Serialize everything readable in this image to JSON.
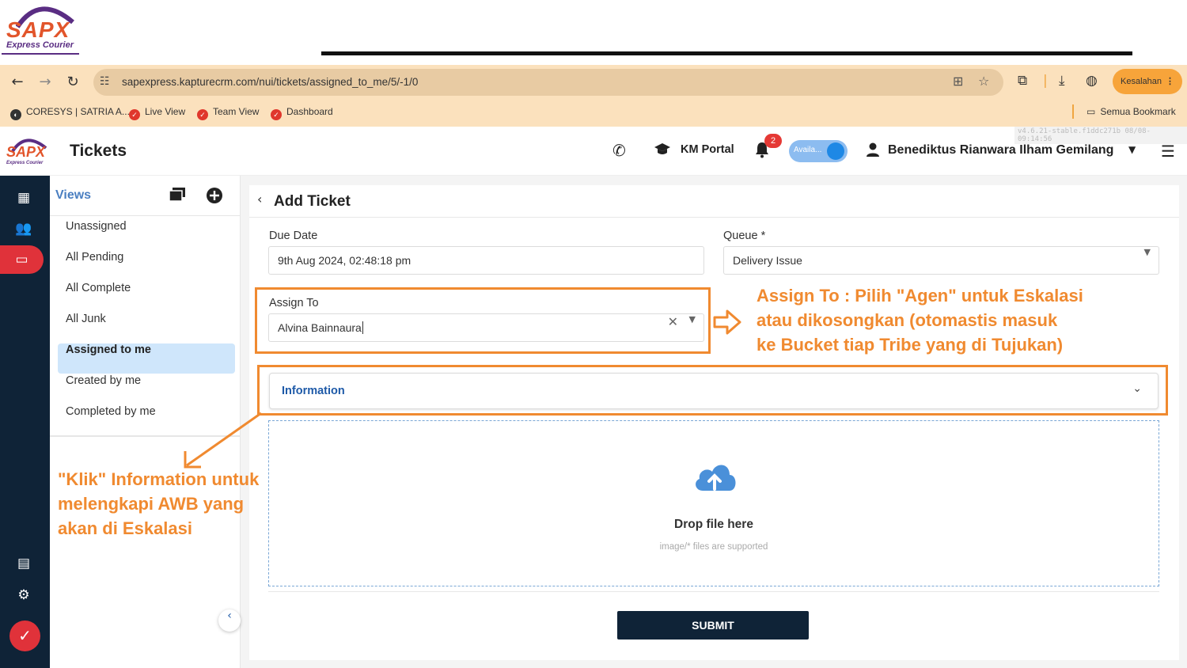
{
  "slide": {
    "logo_word": "SAPX",
    "logo_sub": "Express Courier"
  },
  "browser": {
    "url": "sapexpress.kapturecrm.com/nui/tickets/assigned_to_me/5/-1/0",
    "error_button": "Kesalahan",
    "bookmarks": [
      {
        "label": "CORESYS | SATRIA A..."
      },
      {
        "label": "Live View"
      },
      {
        "label": "Team View"
      },
      {
        "label": "Dashboard"
      }
    ],
    "all_bookmarks": "Semua Bookmark"
  },
  "header": {
    "logo_word": "SAPX",
    "logo_sub": "Express Courier",
    "title": "Tickets",
    "version": "v4.6.21-stable.f1ddc271b 08/08-09:14:56",
    "km_portal": "KM Portal",
    "notification_count": "2",
    "availability": "Availa...",
    "user_name": "Benediktus Rianwara Ilham Gemilang"
  },
  "views": {
    "heading": "Views",
    "items": [
      {
        "label": "Unassigned"
      },
      {
        "label": "All Pending"
      },
      {
        "label": "All Complete"
      },
      {
        "label": "All Junk"
      },
      {
        "label": "Assigned to me"
      },
      {
        "label": "Created by me"
      },
      {
        "label": "Completed by me"
      }
    ]
  },
  "form": {
    "title": "Add Ticket",
    "due_date_label": "Due Date",
    "due_date_value": "9th Aug 2024, 02:48:18 pm",
    "queue_label": "Queue *",
    "queue_value": "Delivery Issue",
    "assign_label": "Assign To",
    "assign_value": "Alvina Bainnaura",
    "information_label": "Information",
    "drop_title": "Drop file here",
    "drop_sub": "image/* files are supported",
    "submit_label": "SUBMIT"
  },
  "annotations": {
    "assign_note_lines": [
      "Assign To : Pilih \"Agen\" untuk Eskalasi",
      "atau dikosongkan (otomastis masuk",
      "ke Bucket tiap Tribe yang di Tujukan)"
    ],
    "info_note_lines": [
      "\"Klik\" Information untuk",
      "melengkapi AWB yang",
      "akan di Eskalasi"
    ]
  },
  "colors": {
    "annotation": "#f08a30",
    "rail": "#0f2337",
    "rail_active": "#e0323a",
    "selected_view": "#cfe6fb",
    "link_blue": "#1e5aa8",
    "chrome_bg": "#fbe1bd"
  }
}
